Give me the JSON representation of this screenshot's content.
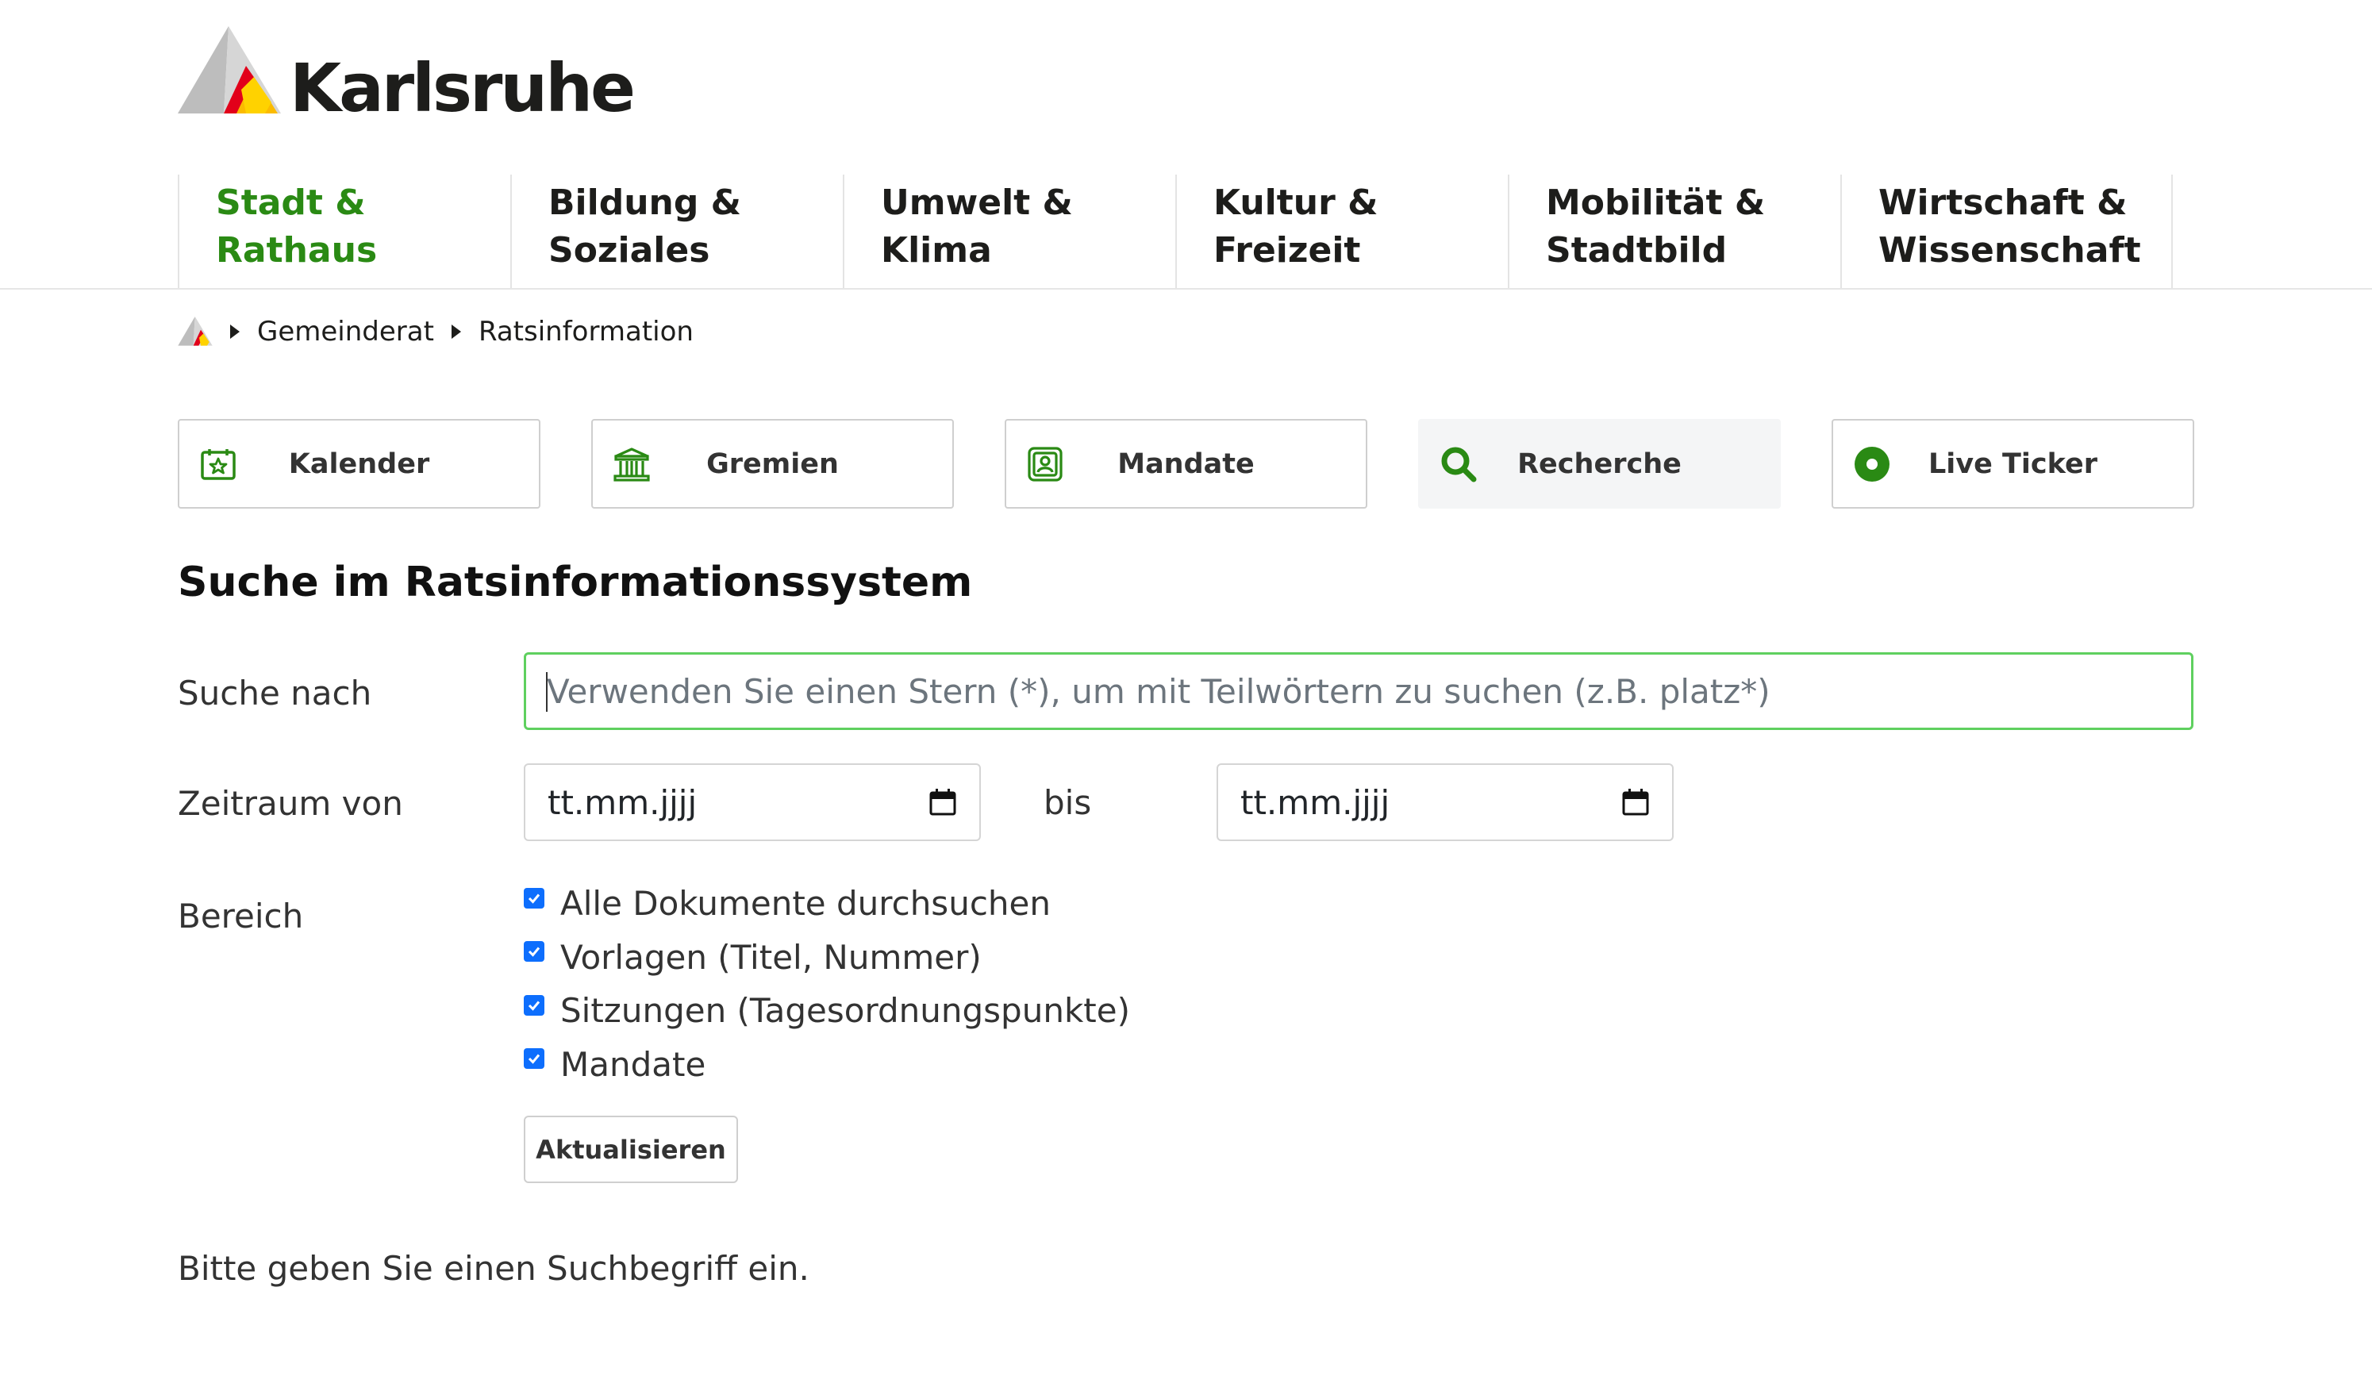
{
  "brand": {
    "name": "Karlsruhe"
  },
  "main_nav": [
    {
      "label_line1": "Stadt &",
      "label_line2": "Rathaus",
      "active": true
    },
    {
      "label_line1": "Bildung &",
      "label_line2": "Soziales",
      "active": false
    },
    {
      "label_line1": "Umwelt &",
      "label_line2": "Klima",
      "active": false
    },
    {
      "label_line1": "Kultur &",
      "label_line2": "Freizeit",
      "active": false
    },
    {
      "label_line1": "Mobilität &",
      "label_line2": "Stadtbild",
      "active": false
    },
    {
      "label_line1": "Wirtschaft &",
      "label_line2": "Wissenschaft",
      "active": false
    }
  ],
  "breadcrumb": {
    "items": [
      "Gemeinderat",
      "Ratsinformation"
    ]
  },
  "tiles": [
    {
      "label": "Kalender",
      "icon": "calendar-star-icon",
      "active": false
    },
    {
      "label": "Gremien",
      "icon": "building-columns-icon",
      "active": false
    },
    {
      "label": "Mandate",
      "icon": "person-badge-icon",
      "active": false
    },
    {
      "label": "Recherche",
      "icon": "search-icon",
      "active": true
    },
    {
      "label": "Live Ticker",
      "icon": "live-dot-icon",
      "active": false
    }
  ],
  "page": {
    "title": "Suche im Ratsinformationssystem"
  },
  "form": {
    "search_label": "Suche nach",
    "search_placeholder": "Verwenden Sie einen Stern (*), um mit Teilwörtern zu suchen (z.B. platz*)",
    "search_value": "",
    "period_label": "Zeitraum von",
    "date_from": "tt.mm.jjjj",
    "to_label": "bis",
    "date_to": "tt.mm.jjjj",
    "scope_label": "Bereich",
    "scopes": [
      {
        "label": "Alle Dokumente durchsuchen",
        "checked": true
      },
      {
        "label": "Vorlagen (Titel, Nummer)",
        "checked": true
      },
      {
        "label": "Sitzungen (Tagesordnungspunkte)",
        "checked": true
      },
      {
        "label": "Mandate",
        "checked": true
      }
    ],
    "update_button": "Aktualisieren"
  },
  "result_hint": "Bitte geben Sie einen Suchbegriff ein.",
  "colors": {
    "accent": "#2a8a14",
    "search_border": "#5fd05f",
    "checkbox": "#0d6efd",
    "active_tile": "#f4f5f6"
  }
}
